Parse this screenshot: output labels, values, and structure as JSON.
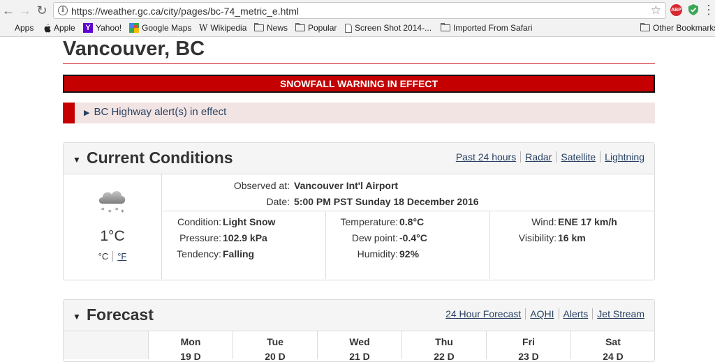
{
  "browser": {
    "url": "https://weather.gc.ca/city/pages/bc-74_metric_e.html",
    "bookmarks": [
      "Apps",
      "Apple",
      "Yahoo!",
      "Google Maps",
      "Wikipedia",
      "News",
      "Popular",
      "Screen Shot 2014-...",
      "Imported From Safari"
    ],
    "other_bookmarks": "Other Bookmarks",
    "ext_abp": "ABP"
  },
  "page": {
    "title": "Vancouver, BC",
    "warning": "SNOWFALL WARNING IN EFFECT",
    "alert": "BC Highway alert(s) in effect"
  },
  "current": {
    "heading": "Current Conditions",
    "links": [
      "Past 24 hours",
      "Radar",
      "Satellite",
      "Lightning"
    ],
    "temp": "1°C",
    "unit_c": "°C",
    "unit_f": "°F",
    "observed_label": "Observed at:",
    "observed_value": "Vancouver Int'l Airport",
    "date_label": "Date:",
    "date_value": "5:00 PM PST Sunday 18 December 2016",
    "condition_label": "Condition:",
    "condition_value": "Light Snow",
    "pressure_label": "Pressure:",
    "pressure_value": "102.9 kPa",
    "tendency_label": "Tendency:",
    "tendency_value": "Falling",
    "temperature_label": "Temperature:",
    "temperature_value": "0.8°C",
    "dewpoint_label": "Dew point:",
    "dewpoint_value": "-0.4°C",
    "humidity_label": "Humidity:",
    "humidity_value": "92%",
    "wind_label": "Wind:",
    "wind_value": "ENE 17 km/h",
    "visibility_label": "Visibility:",
    "visibility_value": "16 km"
  },
  "forecast": {
    "heading": "Forecast",
    "links": [
      "24 Hour Forecast",
      "AQHI",
      "Alerts",
      "Jet Stream"
    ],
    "days": [
      {
        "day": "Mon",
        "date": "19 D"
      },
      {
        "day": "Tue",
        "date": "20 D"
      },
      {
        "day": "Wed",
        "date": "21 D"
      },
      {
        "day": "Thu",
        "date": "22 D"
      },
      {
        "day": "Fri",
        "date": "23 D"
      },
      {
        "day": "Sat",
        "date": "24 D"
      }
    ]
  }
}
